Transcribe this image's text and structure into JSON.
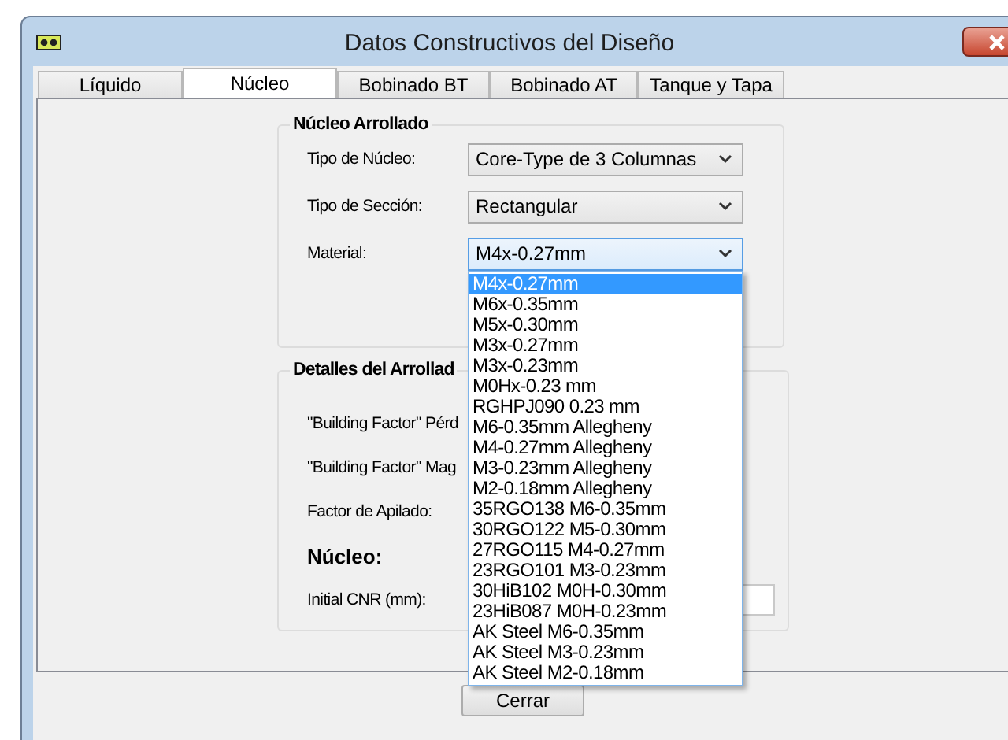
{
  "window": {
    "title": "Datos Constructivos del Diseño"
  },
  "tabs": [
    {
      "label": "Líquido",
      "selected": false
    },
    {
      "label": "Núcleo",
      "selected": true
    },
    {
      "label": "Bobinado BT",
      "selected": false
    },
    {
      "label": "Bobinado AT",
      "selected": false
    },
    {
      "label": "Tanque y Tapa",
      "selected": false
    }
  ],
  "core_group": {
    "title": "Núcleo Arrollado",
    "fields": [
      {
        "label": "Tipo de Núcleo:",
        "value": "Core-Type de 3 Columnas",
        "focused": false
      },
      {
        "label": "Tipo de Sección:",
        "value": "Rectangular",
        "focused": false
      },
      {
        "label": "Material:",
        "value": "M4x-0.27mm",
        "focused": true
      }
    ]
  },
  "material_options": [
    {
      "label": "M4x-0.27mm",
      "selected": true
    },
    {
      "label": "M6x-0.35mm",
      "selected": false
    },
    {
      "label": "M5x-0.30mm",
      "selected": false
    },
    {
      "label": "M3x-0.27mm",
      "selected": false
    },
    {
      "label": "M3x-0.23mm",
      "selected": false
    },
    {
      "label": "M0Hx-0.23 mm",
      "selected": false
    },
    {
      "label": "RGHPJ090 0.23 mm",
      "selected": false
    },
    {
      "label": "M6-0.35mm Allegheny",
      "selected": false
    },
    {
      "label": "M4-0.27mm Allegheny",
      "selected": false
    },
    {
      "label": "M3-0.23mm Allegheny",
      "selected": false
    },
    {
      "label": "M2-0.18mm Allegheny",
      "selected": false
    },
    {
      "label": "35RGO138 M6-0.35mm",
      "selected": false
    },
    {
      "label": "30RGO122 M5-0.30mm",
      "selected": false
    },
    {
      "label": "27RGO115 M4-0.27mm",
      "selected": false
    },
    {
      "label": "23RGO101 M3-0.23mm",
      "selected": false
    },
    {
      "label": "30HiB102 M0H-0.30mm",
      "selected": false
    },
    {
      "label": "23HiB087 M0H-0.23mm",
      "selected": false
    },
    {
      "label": "AK Steel M6-0.35mm",
      "selected": false
    },
    {
      "label": "AK Steel M3-0.23mm",
      "selected": false
    },
    {
      "label": "AK Steel M2-0.18mm",
      "selected": false
    }
  ],
  "winding_group": {
    "title": "Detalles del Arrollad",
    "rows": [
      {
        "label": "\"Building Factor\" Pérd",
        "kind": "text"
      },
      {
        "label": "\"Building Factor\" Mag",
        "kind": "text"
      },
      {
        "label": "Factor de Apilado:",
        "kind": "text"
      },
      {
        "label": "Núcleo:",
        "kind": "heading"
      },
      {
        "label": "Initial CNR (mm):",
        "kind": "field"
      }
    ]
  },
  "buttons": [
    {
      "label": "Cerrar"
    }
  ]
}
